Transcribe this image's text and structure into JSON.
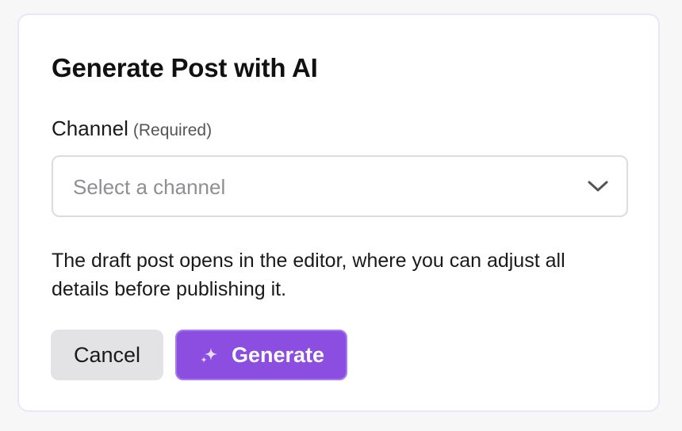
{
  "dialog": {
    "title": "Generate Post with AI",
    "channel_field": {
      "label": "Channel",
      "required_note": "(Required)",
      "placeholder": "Select a channel",
      "icon": "chevron-down-icon"
    },
    "hint": "The draft post opens in the editor, where you can adjust all details before publishing it.",
    "buttons": {
      "cancel_label": "Cancel",
      "generate_label": "Generate",
      "generate_icon": "sparkle-icon"
    }
  },
  "colors": {
    "accent": "#8c4ee0",
    "accent_border": "#a679ee",
    "cancel_bg": "#e3e3e6",
    "dialog_border": "#ece4fb"
  }
}
